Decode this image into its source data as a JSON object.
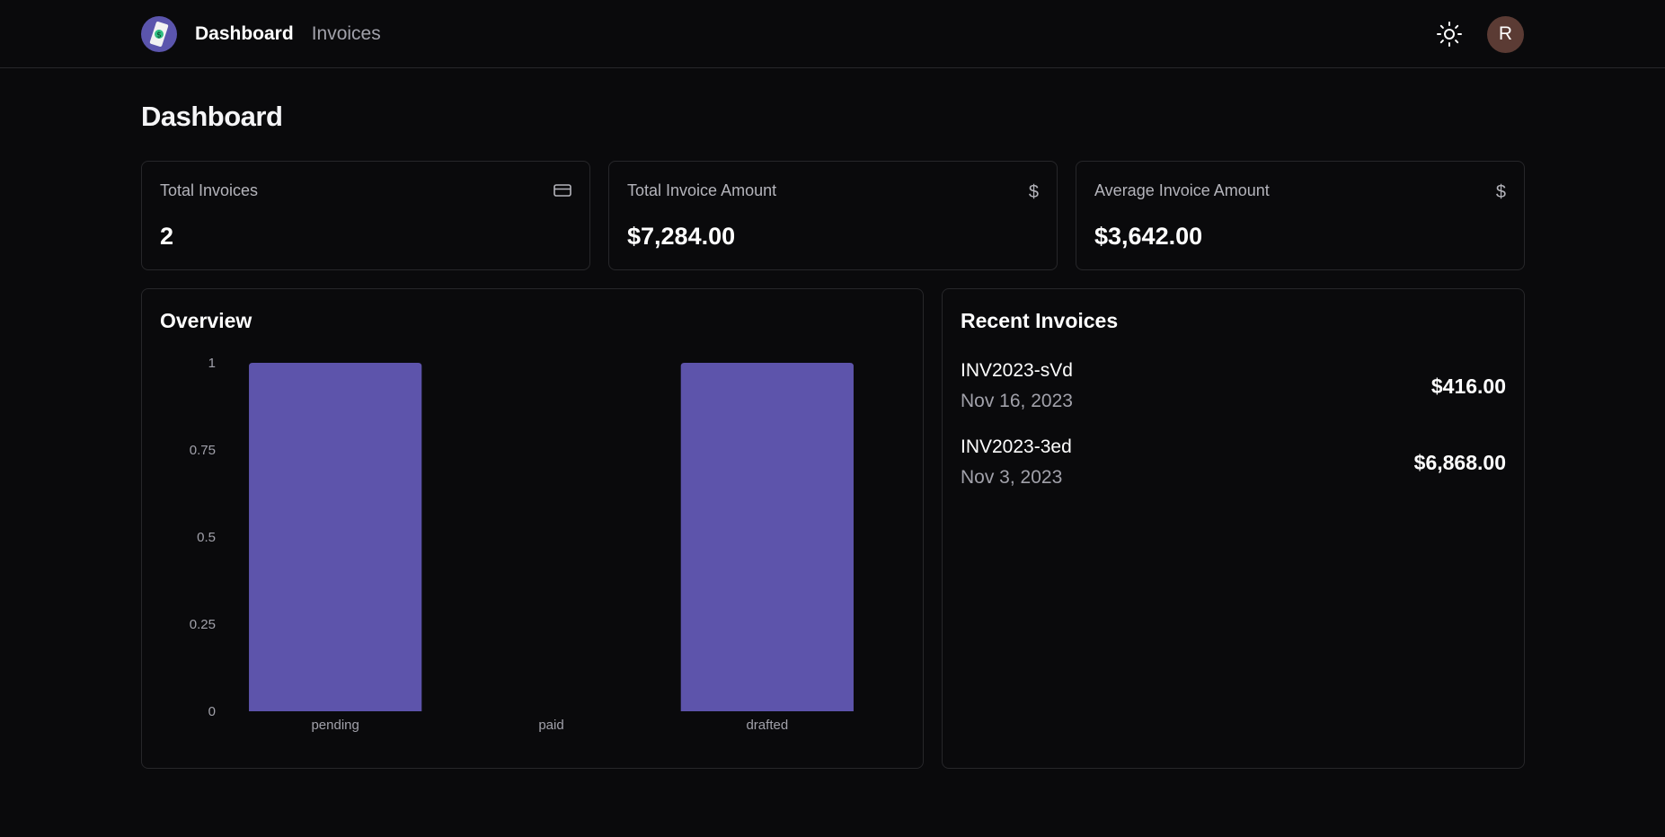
{
  "nav": {
    "logo_icon": "invoice-logo-icon",
    "links": [
      {
        "label": "Dashboard",
        "active": true
      },
      {
        "label": "Invoices",
        "active": false
      }
    ],
    "theme_icon": "sun-icon",
    "avatar_initial": "R"
  },
  "page": {
    "title": "Dashboard"
  },
  "stats": [
    {
      "title": "Total Invoices",
      "value": "2",
      "icon": "credit-card-icon"
    },
    {
      "title": "Total Invoice Amount",
      "value": "$7,284.00",
      "icon": "dollar-icon"
    },
    {
      "title": "Average Invoice Amount",
      "value": "$3,642.00",
      "icon": "dollar-icon"
    }
  ],
  "overview": {
    "title": "Overview"
  },
  "chart_data": {
    "type": "bar",
    "title": "",
    "xlabel": "",
    "ylabel": "",
    "categories": [
      "pending",
      "paid",
      "drafted"
    ],
    "values": [
      1,
      0,
      1
    ],
    "ylim": [
      0,
      1
    ],
    "yticks": [
      "0",
      "0.25",
      "0.5",
      "0.75",
      "1"
    ],
    "bar_color": "#5d54ab",
    "grid": false
  },
  "recent": {
    "title": "Recent Invoices",
    "items": [
      {
        "id": "INV2023-sVd",
        "date": "Nov 16, 2023",
        "amount": "$416.00"
      },
      {
        "id": "INV2023-3ed",
        "date": "Nov 3, 2023",
        "amount": "$6,868.00"
      }
    ]
  },
  "colors": {
    "background": "#0a0a0c",
    "border": "#27272a",
    "accent": "#5d54ab",
    "muted_text": "#a1a1aa",
    "avatar_bg": "#5b3b34"
  }
}
